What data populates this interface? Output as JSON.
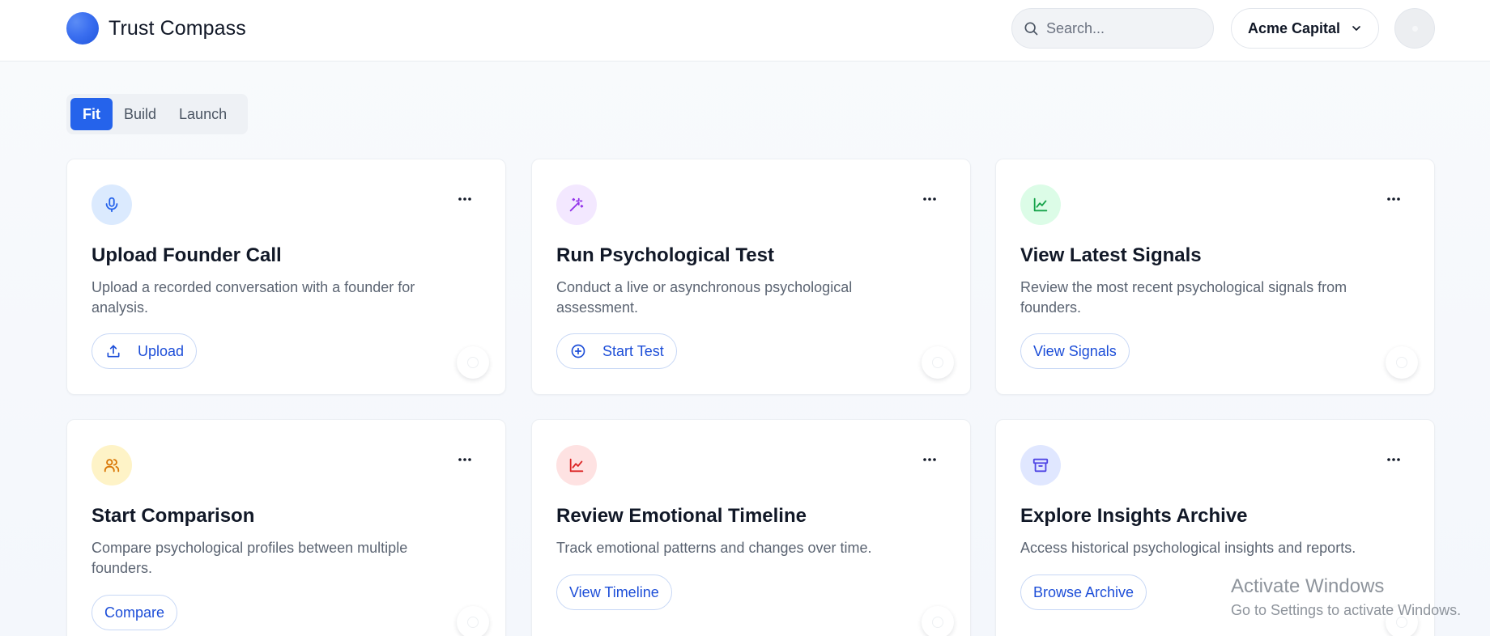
{
  "app": {
    "name": "Trust Compass"
  },
  "search": {
    "placeholder": "Search..."
  },
  "org": {
    "selected": "Acme Capital"
  },
  "tabs": [
    {
      "label": "Fit",
      "active": true
    },
    {
      "label": "Build",
      "active": false
    },
    {
      "label": "Launch",
      "active": false
    }
  ],
  "cards": [
    {
      "icon": "microphone-icon",
      "icon_color": "#2563eb",
      "icon_bg": "#dbeafe",
      "title": "Upload Founder Call",
      "description": "Upload a recorded conversation with a founder for analysis.",
      "button": {
        "label": "Upload",
        "icon": "upload-icon"
      }
    },
    {
      "icon": "magic-wand-icon",
      "icon_color": "#9333ea",
      "icon_bg": "#f3e8ff",
      "title": "Run Psychological Test",
      "description": "Conduct a live or asynchronous psychological assessment.",
      "button": {
        "label": "Start Test",
        "icon": "plus-circle-icon"
      }
    },
    {
      "icon": "line-chart-icon",
      "icon_color": "#16a34a",
      "icon_bg": "#dcfce7",
      "title": "View Latest Signals",
      "description": "Review the most recent psychological signals from founders.",
      "button": {
        "label": "View Signals",
        "icon": null
      }
    },
    {
      "icon": "users-icon",
      "icon_color": "#d97706",
      "icon_bg": "#fef3c7",
      "title": "Start Comparison",
      "description": "Compare psychological profiles between multiple founders.",
      "button": {
        "label": "Compare",
        "icon": null
      }
    },
    {
      "icon": "line-chart-icon",
      "icon_color": "#dc2626",
      "icon_bg": "#fee2e2",
      "title": "Review Emotional Timeline",
      "description": "Track emotional patterns and changes over time.",
      "button": {
        "label": "View Timeline",
        "icon": null
      }
    },
    {
      "icon": "archive-icon",
      "icon_color": "#4f46e5",
      "icon_bg": "#e0e7ff",
      "title": "Explore Insights Archive",
      "description": "Access historical psychological insights and reports.",
      "button": {
        "label": "Browse Archive",
        "icon": null
      }
    }
  ],
  "watermark": {
    "title": "Activate Windows",
    "subtitle": "Go to Settings to activate Windows."
  }
}
